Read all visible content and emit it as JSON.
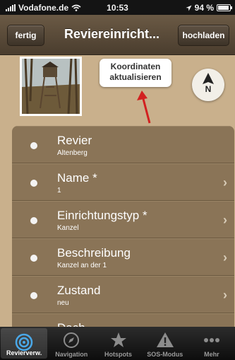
{
  "statusbar": {
    "carrier": "Vodafone.de",
    "time": "10:53",
    "battery_text": "94 %",
    "battery_level": 0.94
  },
  "navbar": {
    "back_label": "fertig",
    "title": "Reviereinricht...",
    "upload_label": "hochladen"
  },
  "header": {
    "coord_line1": "Koordinaten",
    "coord_line2": "aktualisieren",
    "compass_label": "N"
  },
  "list": {
    "rows": [
      {
        "title": "Revier",
        "sub": "Altenberg",
        "chevron": false
      },
      {
        "title": "Name *",
        "sub": "1",
        "chevron": true
      },
      {
        "title": "Einrichtungstyp *",
        "sub": "Kanzel",
        "chevron": true
      },
      {
        "title": "Beschreibung",
        "sub": "Kanzel an der 1",
        "chevron": true
      },
      {
        "title": "Zustand",
        "sub": "neu",
        "chevron": true
      },
      {
        "title": "Dach",
        "sub": "",
        "chevron": false
      }
    ]
  },
  "tabbar": {
    "tabs": [
      {
        "label": "Revierverw.",
        "icon": "target-icon",
        "active": true
      },
      {
        "label": "Navigation",
        "icon": "compass-icon",
        "active": false
      },
      {
        "label": "Hotspots",
        "icon": "star-icon",
        "active": false
      },
      {
        "label": "SOS-Modus",
        "icon": "warning-icon",
        "active": false
      },
      {
        "label": "Mehr",
        "icon": "more-icon",
        "active": false
      }
    ]
  },
  "colors": {
    "background": "#c9b08c",
    "list_bg": "#8a7457",
    "accent_red": "#d22020",
    "tab_active": "#4aa8e8"
  }
}
